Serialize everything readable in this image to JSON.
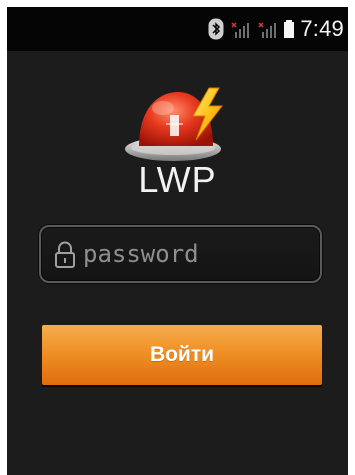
{
  "status_bar": {
    "time": "7:49",
    "icons": [
      "bluetooth-icon",
      "signal-no-service-icon",
      "signal-no-service-icon",
      "battery-icon"
    ],
    "colors": {
      "background": "#050505",
      "text": "#f5f5f5",
      "no_service_x": "#d83a3a",
      "signal": "#6f6f6f",
      "battery": "#f5f5f5"
    }
  },
  "app": {
    "logo_text": "LWP",
    "logo_icon": "siren-lightning-icon",
    "background": "#1c1c1c"
  },
  "login_form": {
    "password_placeholder": "password",
    "password_value": "",
    "submit_label": "Войти",
    "accent_color": "#ef9026"
  }
}
